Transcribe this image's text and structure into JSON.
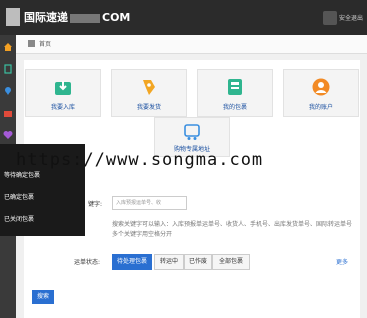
{
  "header": {
    "brand_left": "国际速递",
    "brand_right": "COM",
    "logout": "安全退出"
  },
  "breadcrumb": {
    "label": "首页"
  },
  "cards": [
    {
      "label": "我要入库"
    },
    {
      "label": "我要发货"
    },
    {
      "label": "我的包裹"
    },
    {
      "label": "我的账户"
    },
    {
      "label": "购物专属地址"
    }
  ],
  "dropdown": {
    "items": [
      "等待确定包裹",
      "已确定包裹",
      "已关闭包裹"
    ]
  },
  "watermark": "https://www.songma.com",
  "form": {
    "keyword_label": "键字:",
    "keyword_placeholder": "入库预报运单号、收",
    "hint": "搜索关键字可以输入：入库预报单运单号、收货人、手机号、出库发货单号、国际转运单号 多个关键字用空格分开",
    "status_label": "运单状态:",
    "status_buttons": [
      "待处理包裹",
      "转运中",
      "已作废",
      "全部包裹"
    ],
    "more": "更多",
    "search_button": "搜索"
  }
}
